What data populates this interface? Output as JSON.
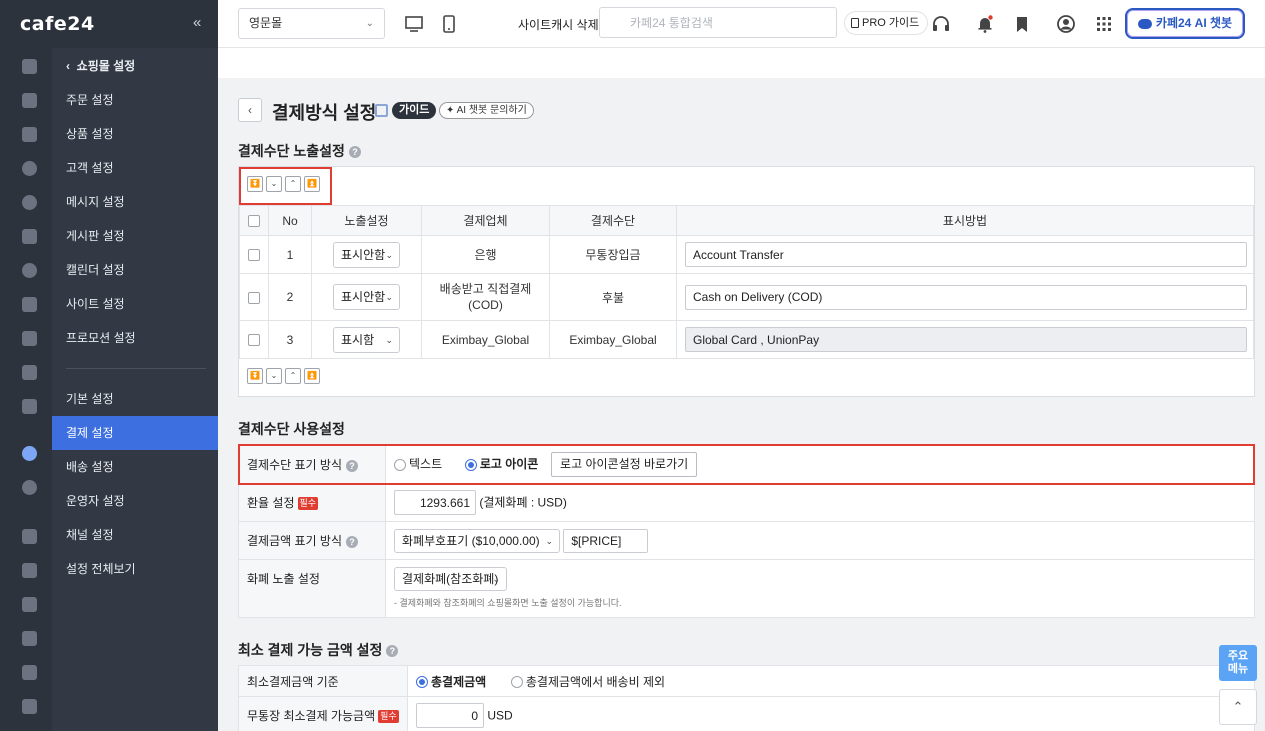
{
  "brand": {
    "logo": "cafe24",
    "collapse": "«"
  },
  "rail_icons": [
    "home-icon",
    "cart-icon",
    "shirt-icon",
    "person-icon",
    "chat-icon",
    "board-icon",
    "palette-icon",
    "window-icon",
    "chart-icon",
    "grid-icon",
    "book-icon",
    "location-icon",
    "globe-icon",
    "truck-icon",
    "play-icon",
    "bag-icon",
    "megaphone-icon",
    "tent-icon",
    "print-icon"
  ],
  "submenu": {
    "back": "쇼핑몰 설정",
    "items_top": [
      "주문 설정",
      "상품 설정",
      "고객 설정",
      "메시지 설정",
      "게시판 설정",
      "캘린더 설정",
      "사이트 설정",
      "프로모션 설정"
    ],
    "items_bottom": [
      "기본 설정",
      "결제 설정",
      "배송 설정",
      "운영자 설정",
      "채널 설정",
      "설정 전체보기"
    ],
    "active": "결제 설정"
  },
  "topbar": {
    "store_select": "영문몰",
    "cache_clear": "사이트캐시 삭제",
    "search_placeholder": "카페24 통합검색",
    "pro_guide": "PRO 가이드",
    "ai_chatbot": "카페24 AI 챗봇"
  },
  "page": {
    "title": "결제방식 설정",
    "guide_badge": "가이드",
    "ai_ask": "AI 챗봇 문의하기"
  },
  "exposure": {
    "title": "결제수단 노출설정",
    "headers": [
      "No",
      "노출설정",
      "결제업체",
      "결제수단",
      "표시방법"
    ],
    "rows": [
      {
        "no": "1",
        "visibility": "표시안함",
        "vendor": "은행",
        "method": "무통장입금",
        "display": "Account Transfer",
        "disabled": false
      },
      {
        "no": "2",
        "visibility": "표시안함",
        "vendor": "배송받고 직접결제\n(COD)",
        "method": "후불",
        "display": "Cash on Delivery (COD)",
        "disabled": false
      },
      {
        "no": "3",
        "visibility": "표시함",
        "vendor": "Eximbay_Global",
        "method": "Eximbay_Global",
        "display": "Global Card , UnionPay",
        "disabled": true
      }
    ]
  },
  "usage": {
    "title": "결제수단 사용설정",
    "display_mode_label": "결제수단 표기 방식",
    "opt_text": "텍스트",
    "opt_logo": "로고 아이콘",
    "logo_link_btn": "로고 아이콘설정 바로가기",
    "rate_label": "환율 설정",
    "required": "필수",
    "rate_value": "1293.661",
    "rate_note": "(결제화폐 : USD)",
    "amount_label": "결제금액 표기 방식",
    "amount_select": "화폐부호표기 ($10,000.00)",
    "amount_format": "$[PRICE]",
    "currency_label": "화폐 노출 설정",
    "currency_select": "결제화폐(참조화폐)",
    "currency_note": "- 결제화폐와 참조화폐의 쇼핑몰화면 노출 설정이 가능합니다."
  },
  "minimum": {
    "title": "최소 결제 가능 금액 설정",
    "basis_label": "최소결제금액 기준",
    "opt_total": "총결제금액",
    "opt_excl": "총결제금액에서 배송비 제외",
    "bank_label": "무통장 최소결제 가능금액",
    "bank_value": "0",
    "bank_unit": "USD"
  },
  "float": {
    "main_menu": "주요\n메뉴",
    "top": "⌃"
  }
}
